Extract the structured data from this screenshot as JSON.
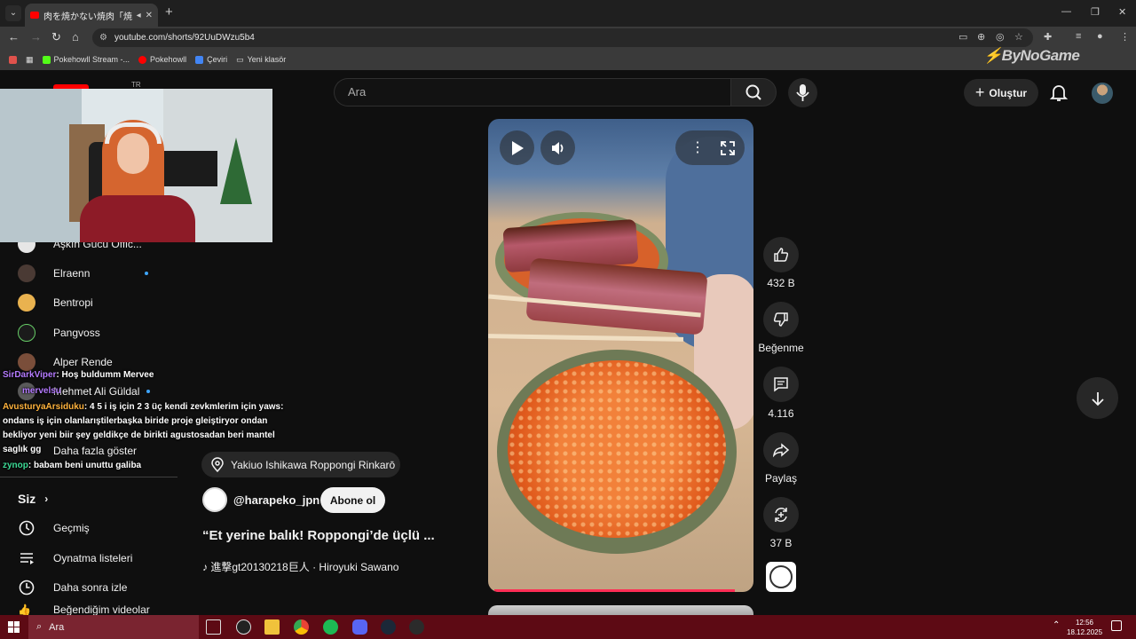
{
  "browser": {
    "tab_title": "肉を焼かない焼肉「焼きうお」",
    "new_tab": "+",
    "url": "youtube.com/shorts/92UuDWzu5b4",
    "window_min": "—",
    "window_restore": "❐",
    "window_close": "✕"
  },
  "bookmarks": [
    {
      "label": "Pokehowll Stream -...",
      "color": "#53fc18"
    },
    {
      "label": "Pokehowll",
      "color": "#ff0000"
    },
    {
      "label": "Çeviri",
      "color": "#4285f4"
    },
    {
      "label": "Yeni klasör",
      "color": "#9aa0a6"
    }
  ],
  "watermark": "ByNoGame",
  "youtube": {
    "search_placeholder": "Ara",
    "create_label": "Oluştur",
    "logo_country": "TR"
  },
  "sidebar": {
    "subscriptions": [
      {
        "name": "Aşkın Gücü Offic...",
        "avatar_color": "#e6e6e6"
      },
      {
        "name": "Elraenn",
        "avatar_color": "#4a3a34",
        "dot": true
      },
      {
        "name": "Bentropi",
        "avatar_color": "#e9b24f"
      },
      {
        "name": "Pangvoss",
        "avatar_color": "#1b1b1b"
      },
      {
        "name": "Alper Rende",
        "avatar_color": "#7a4e3a"
      },
      {
        "name": "Mehmet Ali Güldal",
        "avatar_color": "#5a5a5a",
        "dot": true
      },
      {
        "name": "Daha fazla göster"
      }
    ],
    "you_label": "Siz",
    "you_items": [
      "Geçmiş",
      "Oynatma listeleri",
      "Daha sonra izle",
      "Beğendiğim videolar"
    ]
  },
  "chat": [
    {
      "user": "SirDarkViper",
      "text": ": Hoş buldumm Mervee"
    },
    {
      "user": "mervelsu",
      "text": ""
    },
    {
      "user": "AvusturyaArsiduku",
      "text": ": 4 5 i iş için 2 3 üç kendi zevkmlerim için yaws:"
    },
    {
      "user": "",
      "text": "ondans iş için olanlarıştilerbaşka biride proje gleiştiryor ondan"
    },
    {
      "user": "",
      "text": "bekliyor yeni biir şey geldikçe de birikti agustosadan beri mantel"
    },
    {
      "user": "",
      "text": "saglık gg"
    },
    {
      "user": "zynop",
      "text": ": babam beni unuttu galiba"
    }
  ],
  "short": {
    "location": "Yakiuo Ishikawa Roppongi Rinkarō",
    "channel": "@harapeko_jpn",
    "subscribe": "Abone ol",
    "title": "“Et yerine balık! Roppongi’de üçlü ...",
    "music": "♪ 進撃gt20130218巨人 · Hiroyuki Sawano",
    "likes": "432 B",
    "dislike_label": "Beğenme",
    "comments": "4.116",
    "share_label": "Paylaş",
    "remix": "37 B",
    "progress": 0.95
  },
  "taskbar": {
    "search": "Ara",
    "time": "12:56",
    "date": "18.12.2025"
  }
}
